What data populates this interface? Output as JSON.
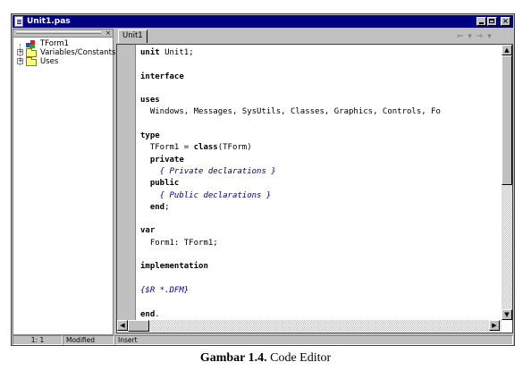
{
  "window": {
    "title": "Unit1.pas"
  },
  "caption_buttons": {
    "minimize": "",
    "maximize": "",
    "close": "×"
  },
  "explorer": {
    "close_glyph": "×",
    "items": [
      {
        "label": "TForm1",
        "icon": "form-icon"
      },
      {
        "label": "Variables/Constants",
        "icon": "folder-icon",
        "expander": "+"
      },
      {
        "label": "Uses",
        "icon": "folder-icon",
        "expander": "+"
      }
    ]
  },
  "tabs": [
    {
      "label": "Unit1"
    }
  ],
  "nav": {
    "back": "⇐ ▾",
    "forward": "⇒ ▾"
  },
  "code": {
    "lines": [
      [
        {
          "t": "unit",
          "k": "kw"
        },
        {
          "t": " Unit1;"
        }
      ],
      [],
      [
        {
          "t": "interface",
          "k": "kw"
        }
      ],
      [],
      [
        {
          "t": "uses",
          "k": "kw"
        }
      ],
      [
        {
          "t": "  Windows, Messages, SysUtils, Classes, Graphics, Controls, Fo"
        }
      ],
      [],
      [
        {
          "t": "type",
          "k": "kw"
        }
      ],
      [
        {
          "t": "  TForm1 = "
        },
        {
          "t": "class",
          "k": "kw"
        },
        {
          "t": "(TForm)"
        }
      ],
      [
        {
          "t": "  "
        },
        {
          "t": "private",
          "k": "kw"
        }
      ],
      [
        {
          "t": "    { Private declarations }",
          "k": "cmt"
        }
      ],
      [
        {
          "t": "  "
        },
        {
          "t": "public",
          "k": "kw"
        }
      ],
      [
        {
          "t": "    { Public declarations }",
          "k": "cmt"
        }
      ],
      [
        {
          "t": "  "
        },
        {
          "t": "end",
          "k": "kw"
        },
        {
          "t": ";"
        }
      ],
      [],
      [
        {
          "t": "var",
          "k": "kw"
        }
      ],
      [
        {
          "t": "  Form1: TForm1;"
        }
      ],
      [],
      [
        {
          "t": "implementation",
          "k": "kw"
        }
      ],
      [],
      [
        {
          "t": "{$R *.DFM}",
          "k": "cmt"
        }
      ],
      [],
      [
        {
          "t": "end",
          "k": "kw"
        },
        {
          "t": "."
        }
      ]
    ]
  },
  "scroll_glyphs": {
    "up": "▲",
    "down": "▼",
    "left": "◀",
    "right": "▶"
  },
  "status": {
    "position": "1:   1",
    "modified": "Modified",
    "mode": "Insert"
  },
  "figure_caption": {
    "label": "Gambar 1.4.",
    "text": " Code Editor"
  },
  "colors": {
    "titlebar": "#000080",
    "face": "#c0c0c0",
    "comment": "#000080"
  }
}
